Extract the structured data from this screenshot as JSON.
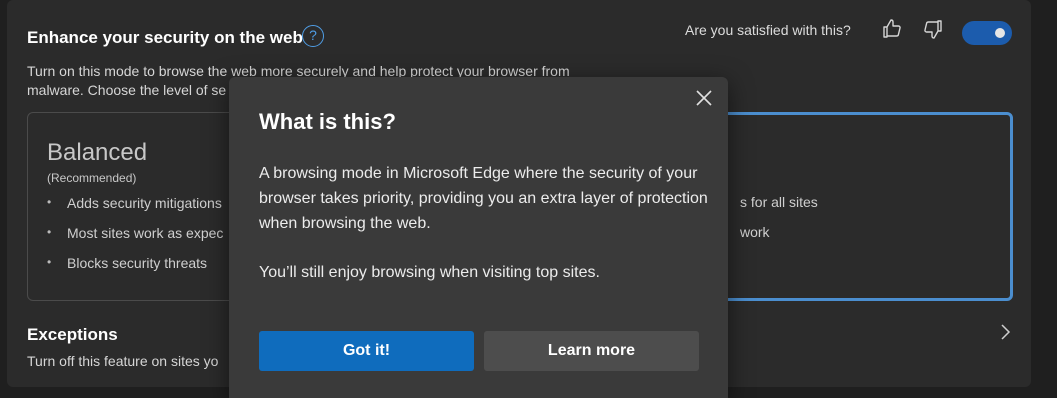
{
  "card": {
    "title": "Enhance your security on the web",
    "help_glyph": "?",
    "feedback_question": "Are you satisfied with this?",
    "toggle_on": true,
    "description": "Turn on this mode to browse the web more securely and help protect your browser from malware. Choose the level of se"
  },
  "balanced": {
    "title": "Balanced",
    "subtitle": "(Recommended)",
    "items": [
      "Adds security mitigations",
      "Most sites work as expec",
      "Blocks security threats"
    ]
  },
  "strict": {
    "items": [
      "s for all sites",
      "work"
    ]
  },
  "exceptions": {
    "title": "Exceptions",
    "description": "Turn off this feature on sites yo"
  },
  "dialog": {
    "title": "What is this?",
    "body": "A browsing mode in Microsoft Edge where the security of your browser takes priority, providing you an extra layer of protection when browsing the web.",
    "body2": "You’ll still enjoy browsing when visiting top sites.",
    "primary_label": "Got it!",
    "secondary_label": "Learn more"
  },
  "colors": {
    "accent": "#0f6cbd",
    "toggle": "#1c5cad",
    "selected_border": "#4b8ecf",
    "background": "#1f1f1f",
    "card": "#2b2b2b",
    "dialog": "#3a3a3a"
  },
  "icons": [
    "help-icon",
    "thumbs-up-icon",
    "thumbs-down-icon",
    "chevron-right-icon",
    "close-icon"
  ]
}
